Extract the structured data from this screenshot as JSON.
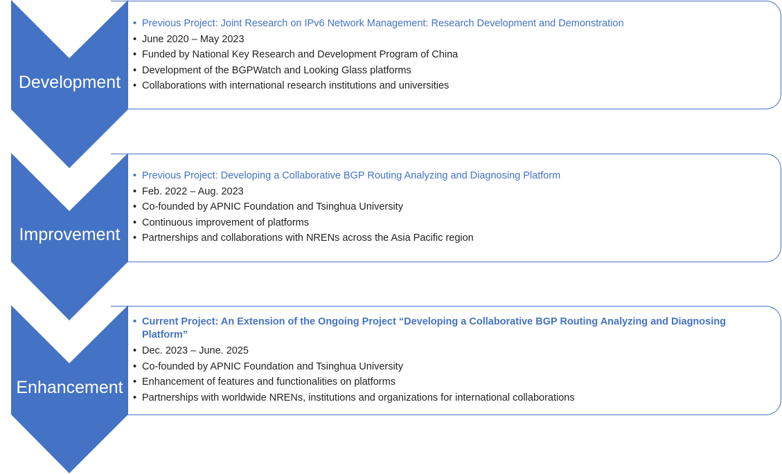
{
  "colors": {
    "accent": "#4472c4",
    "text": "#222222",
    "label": "#ffffff"
  },
  "stages": [
    {
      "label": "Development",
      "project": "Previous Project: Joint Research on IPv6 Network Management: Research Development and Demonstration",
      "bullets": [
        "June 2020 – May 2023",
        "Funded by National Key Research and Development Program of China",
        "Development of the BGPWatch and Looking Glass platforms",
        "Collaborations with international research institutions and universities"
      ]
    },
    {
      "label": "Improvement",
      "project": "Previous Project: Developing a Collaborative BGP Routing Analyzing and Diagnosing Platform",
      "bullets": [
        "Feb. 2022 – Aug. 2023",
        "Co-founded by APNIC Foundation and Tsinghua University",
        "Continuous improvement of platforms",
        "Partnerships and collaborations with NRENs across the Asia Pacific region"
      ]
    },
    {
      "label": "Enhancement",
      "project": "Current Project: An Extension of the Ongoing Project “Developing a Collaborative BGP Routing Analyzing and Diagnosing Platform”",
      "bullets": [
        "Dec. 2023 – June. 2025",
        "Co-founded by APNIC Foundation and Tsinghua University",
        "Enhancement of features and functionalities on platforms",
        "Partnerships with worldwide NRENs, institutions and organizations for international collaborations"
      ]
    }
  ]
}
